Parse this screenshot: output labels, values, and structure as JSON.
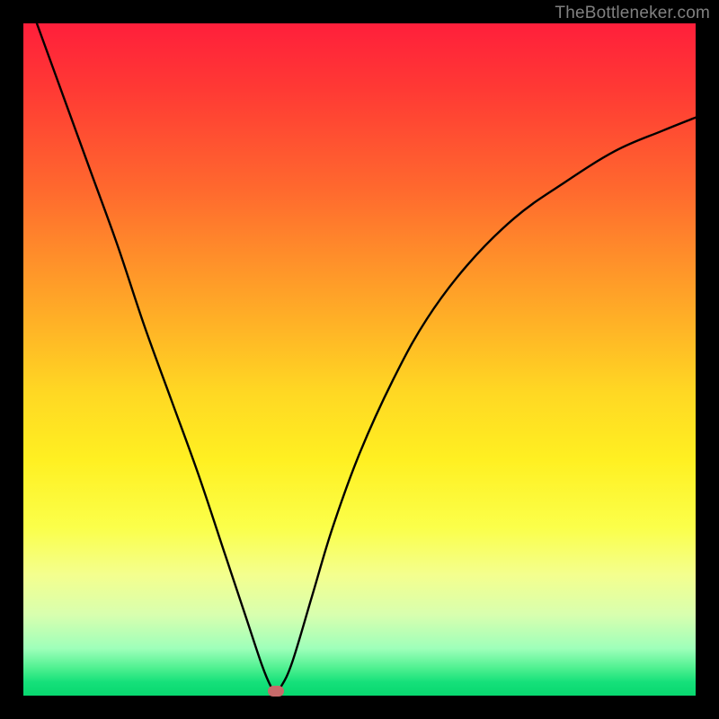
{
  "watermark": "TheBottleneker.com",
  "chart_data": {
    "type": "line",
    "title": "",
    "xlabel": "",
    "ylabel": "",
    "xlim": [
      0,
      100
    ],
    "ylim": [
      0,
      100
    ],
    "background_gradient": {
      "direction": "vertical",
      "stops": [
        {
          "pos": 0,
          "color": "#ff1f3b",
          "meaning": "bad"
        },
        {
          "pos": 50,
          "color": "#ffd020",
          "meaning": "mid"
        },
        {
          "pos": 100,
          "color": "#08d86f",
          "meaning": "good"
        }
      ]
    },
    "curve_points": [
      {
        "x": 2,
        "y": 100
      },
      {
        "x": 6,
        "y": 89
      },
      {
        "x": 10,
        "y": 78
      },
      {
        "x": 14,
        "y": 67
      },
      {
        "x": 18,
        "y": 55
      },
      {
        "x": 22,
        "y": 44
      },
      {
        "x": 26,
        "y": 33
      },
      {
        "x": 30,
        "y": 21
      },
      {
        "x": 33,
        "y": 12
      },
      {
        "x": 35.5,
        "y": 4.5
      },
      {
        "x": 36.8,
        "y": 1.4
      },
      {
        "x": 37.5,
        "y": 0.7
      },
      {
        "x": 38.3,
        "y": 1.3
      },
      {
        "x": 40,
        "y": 5
      },
      {
        "x": 43,
        "y": 15
      },
      {
        "x": 46,
        "y": 25
      },
      {
        "x": 50,
        "y": 36
      },
      {
        "x": 55,
        "y": 47
      },
      {
        "x": 60,
        "y": 56
      },
      {
        "x": 66,
        "y": 64
      },
      {
        "x": 73,
        "y": 71
      },
      {
        "x": 80,
        "y": 76
      },
      {
        "x": 88,
        "y": 81
      },
      {
        "x": 95,
        "y": 84
      },
      {
        "x": 100,
        "y": 86
      }
    ],
    "marker": {
      "x": 37.5,
      "y": 0.7,
      "color": "#c76a6a"
    }
  }
}
